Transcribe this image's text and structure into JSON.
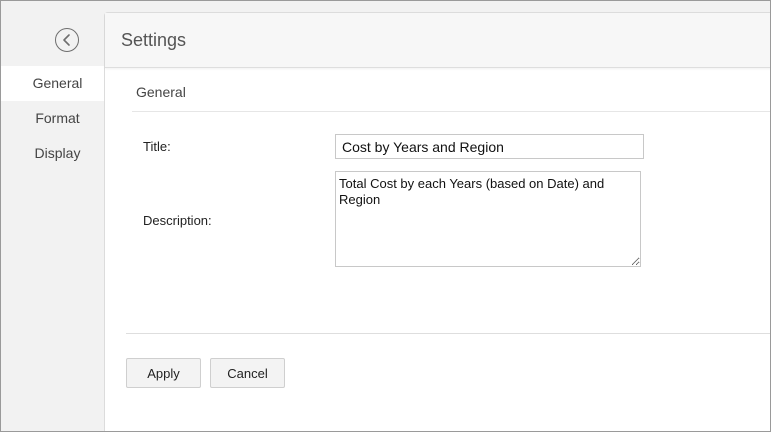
{
  "sidebar": {
    "back_icon": "chevron-left-circle-icon",
    "items": [
      {
        "label": "General",
        "active": true
      },
      {
        "label": "Format",
        "active": false
      },
      {
        "label": "Display",
        "active": false
      }
    ]
  },
  "panel": {
    "title": "Settings",
    "section_title": "General"
  },
  "form": {
    "title_label": "Title:",
    "title_value": "Cost by Years and Region",
    "description_label": "Description:",
    "description_value": "Total Cost by each Years (based on Date) and Region"
  },
  "actions": {
    "apply_label": "Apply",
    "cancel_label": "Cancel"
  },
  "colors": {
    "sidebar_bg": "#f2f2f2",
    "active_item_bg": "#ffffff",
    "header_bg": "#f7f7f7",
    "button_bg": "#f3f3f3"
  }
}
